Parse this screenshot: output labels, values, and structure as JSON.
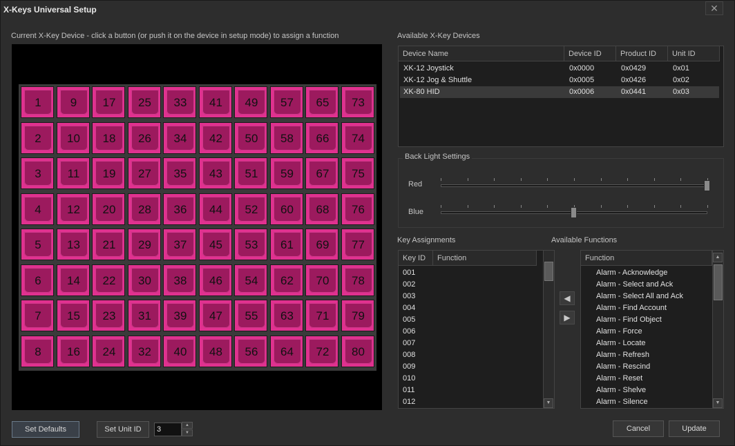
{
  "window": {
    "title": "X-Keys Universal Setup",
    "close_label": "✕"
  },
  "device_area": {
    "label": "Current X-Key Device - click a button  (or push it on the device in setup mode) to assign a function"
  },
  "keys": [
    [
      "1",
      "9",
      "17",
      "25",
      "33",
      "41",
      "49",
      "57",
      "65",
      "73"
    ],
    [
      "2",
      "10",
      "18",
      "26",
      "34",
      "42",
      "50",
      "58",
      "66",
      "74"
    ],
    [
      "3",
      "11",
      "19",
      "27",
      "35",
      "43",
      "51",
      "59",
      "67",
      "75"
    ],
    [
      "4",
      "12",
      "20",
      "28",
      "36",
      "44",
      "52",
      "60",
      "68",
      "76"
    ],
    [
      "5",
      "13",
      "21",
      "29",
      "37",
      "45",
      "53",
      "61",
      "69",
      "77"
    ],
    [
      "6",
      "14",
      "22",
      "30",
      "38",
      "46",
      "54",
      "62",
      "70",
      "78"
    ],
    [
      "7",
      "15",
      "23",
      "31",
      "39",
      "47",
      "55",
      "63",
      "71",
      "79"
    ],
    [
      "8",
      "16",
      "24",
      "32",
      "40",
      "48",
      "56",
      "64",
      "72",
      "80"
    ]
  ],
  "devices": {
    "label": "Available X-Key Devices",
    "columns": [
      "Device Name",
      "Device ID",
      "Product ID",
      "Unit ID"
    ],
    "rows": [
      {
        "name": "XK-12 Joystick",
        "device_id": "0x0000",
        "product_id": "0x0429",
        "unit_id": "0x01"
      },
      {
        "name": "XK-12 Jog & Shuttle",
        "device_id": "0x0005",
        "product_id": "0x0426",
        "unit_id": "0x02"
      },
      {
        "name": "XK-80 HID",
        "device_id": "0x0006",
        "product_id": "0x0441",
        "unit_id": "0x03"
      }
    ],
    "selected_index": 2
  },
  "backlight": {
    "label": "Back Light Settings",
    "red_label": "Red",
    "blue_label": "Blue",
    "red_level": 1.0,
    "blue_level": 0.5
  },
  "key_assignments": {
    "label": "Key Assignments",
    "columns": [
      "Key ID",
      "Function"
    ],
    "rows": [
      "001",
      "002",
      "003",
      "004",
      "005",
      "006",
      "007",
      "008",
      "009",
      "010",
      "011",
      "012"
    ]
  },
  "functions": {
    "label": "Available Functions",
    "column": "Function",
    "rows": [
      "Alarm - Acknowledge",
      "Alarm - Select and Ack",
      "Alarm - Select All and Ack",
      "Alarm - Find Account",
      "Alarm - Find Object",
      "Alarm - Force",
      "Alarm - Locate",
      "Alarm - Refresh",
      "Alarm - Rescind",
      "Alarm - Reset",
      "Alarm - Shelve",
      "Alarm - Silence"
    ]
  },
  "buttons": {
    "set_defaults": "Set Defaults",
    "set_unit_id": "Set Unit ID",
    "unit_id_value": "3",
    "cancel": "Cancel",
    "update": "Update",
    "assign_left": "◀",
    "assign_right": "▶"
  },
  "colors": {
    "key_face": "#e0318f",
    "key_inner": "#9c1a5e"
  }
}
